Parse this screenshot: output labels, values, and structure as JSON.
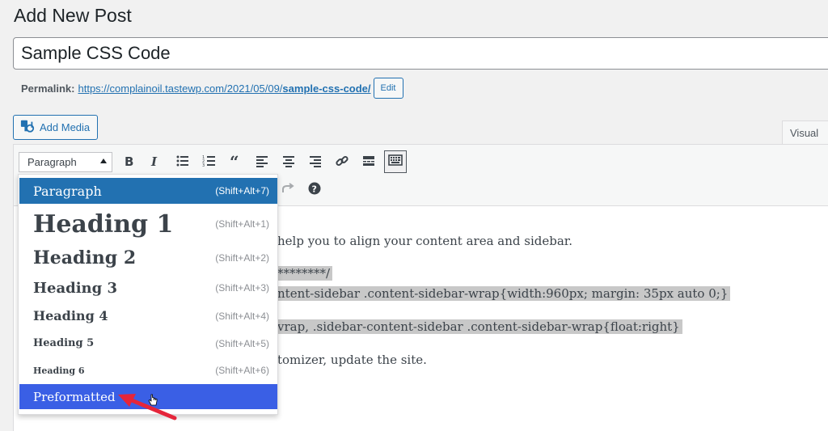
{
  "page": {
    "title": "Add New Post"
  },
  "post": {
    "title": "Sample CSS Code"
  },
  "permalink": {
    "label": "Permalink:",
    "url_prefix": "https://complainoil.tastewp.com/2021/05/09/",
    "slug": "sample-css-code/",
    "edit_label": "Edit"
  },
  "media": {
    "add_media_label": "Add Media"
  },
  "editor": {
    "visual_tab_label": "Visual",
    "format_selected": "Paragraph",
    "toolbar_icons": [
      "bold-icon",
      "italic-icon",
      "bulleted-list-icon",
      "numbered-list-icon",
      "blockquote-icon",
      "align-left-icon",
      "align-center-icon",
      "align-right-icon",
      "link-icon",
      "read-more-icon",
      "toolbar-toggle-icon",
      "redo-icon",
      "help-icon"
    ],
    "content": {
      "line1": "help you to align your content area and sidebar.",
      "line2": "********/",
      "line3": "ntent-sidebar .content-sidebar-wrap{width:960px; margin: 35px auto 0;}",
      "line4": "vrap, .sidebar-content-sidebar .content-sidebar-wrap{float:right}",
      "line5": "tomizer, update the site."
    }
  },
  "format_dropdown": {
    "items": [
      {
        "label": "Paragraph",
        "shortcut": "(Shift+Alt+7)"
      },
      {
        "label": "Heading 1",
        "shortcut": "(Shift+Alt+1)"
      },
      {
        "label": "Heading 2",
        "shortcut": "(Shift+Alt+2)"
      },
      {
        "label": "Heading 3",
        "shortcut": "(Shift+Alt+3)"
      },
      {
        "label": "Heading 4",
        "shortcut": "(Shift+Alt+4)"
      },
      {
        "label": "Heading 5",
        "shortcut": "(Shift+Alt+5)"
      },
      {
        "label": "Heading 6",
        "shortcut": "(Shift+Alt+6)"
      },
      {
        "label": "Preformatted",
        "shortcut": ""
      }
    ]
  },
  "colors": {
    "accent": "#2271b1",
    "hover_item": "#3a5fe5",
    "annotation_arrow": "#e5253a",
    "code_highlight": "#c8c8c8"
  }
}
